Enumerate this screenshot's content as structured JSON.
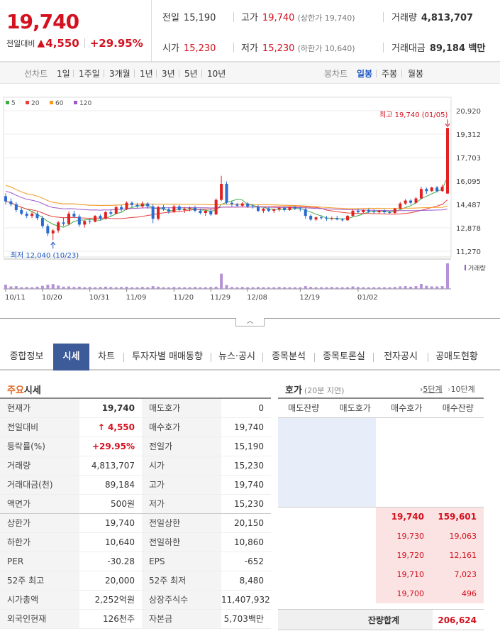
{
  "header": {
    "current_price": "19,740",
    "change_label": "전일대비",
    "change_amount": "4,550",
    "change_rate": "+29.95%",
    "prev_close_label": "전일",
    "prev_close": "15,190",
    "high_label": "고가",
    "high": "19,740",
    "upper_limit": "(상한가 19,740)",
    "volume_label": "거래량",
    "volume": "4,813,707",
    "open_label": "시가",
    "open": "15,230",
    "low_label": "저가",
    "low": "15,230",
    "lower_limit": "(하한가 10,640)",
    "amount_label": "거래대금",
    "amount": "89,184 백만"
  },
  "period_bar": {
    "line_label": "선차트",
    "line_periods": [
      "1일",
      "1주일",
      "3개월",
      "1년",
      "3년",
      "5년",
      "10년"
    ],
    "candle_label": "봉차트",
    "candle_periods": [
      "일봉",
      "주봉",
      "월봉"
    ],
    "active_candle": "일봉"
  },
  "chart_data": {
    "type": "candlestick",
    "ma_legend": [
      {
        "name": "5",
        "color": "#3fae49"
      },
      {
        "name": "20",
        "color": "#e8413b"
      },
      {
        "name": "60",
        "color": "#f39a1f"
      },
      {
        "name": "120",
        "color": "#9b59c9"
      }
    ],
    "y_ticks": [
      "20,920",
      "19,312",
      "17,703",
      "16,095",
      "14,487",
      "12,878",
      "11,270"
    ],
    "ylim": [
      11270,
      20920
    ],
    "x_ticks": [
      "10/11",
      "10/20",
      "10/31",
      "11/09",
      "11/20",
      "11/29",
      "12/08",
      "12/19",
      "01/02"
    ],
    "high_annotation": "최고 19,740 (01/05)",
    "low_annotation": "최저 12,040 (10/23)",
    "volume_label": "거래량",
    "candles": [
      [
        15050,
        15250,
        14500,
        14700
      ],
      [
        14700,
        14900,
        14350,
        14500
      ],
      [
        14500,
        14650,
        13950,
        14100
      ],
      [
        14100,
        14250,
        13750,
        13850
      ],
      [
        13850,
        14000,
        13550,
        13700
      ],
      [
        13700,
        14000,
        13550,
        13850
      ],
      [
        13850,
        14000,
        13400,
        13550
      ],
      [
        13550,
        13700,
        12850,
        13000
      ],
      [
        13000,
        13150,
        12300,
        12500
      ],
      [
        12500,
        12800,
        12040,
        12700
      ],
      [
        12700,
        13350,
        12550,
        13250
      ],
      [
        13250,
        13600,
        13000,
        13150
      ],
      [
        13150,
        14000,
        13050,
        13850
      ],
      [
        13850,
        14050,
        13550,
        13650
      ],
      [
        13650,
        13800,
        12950,
        13100
      ],
      [
        13100,
        13400,
        12900,
        13350
      ],
      [
        13350,
        13500,
        13150,
        13300
      ],
      [
        13300,
        13750,
        13250,
        13700
      ],
      [
        13700,
        13800,
        13400,
        13500
      ],
      [
        13500,
        14050,
        13450,
        13950
      ],
      [
        13950,
        14150,
        13700,
        13850
      ],
      [
        13850,
        14400,
        13800,
        14300
      ],
      [
        14300,
        14450,
        14000,
        14150
      ],
      [
        14150,
        14700,
        14100,
        14600
      ],
      [
        14600,
        14700,
        14300,
        14450
      ],
      [
        14450,
        14600,
        14250,
        14350
      ],
      [
        14350,
        14700,
        14250,
        14550
      ],
      [
        14550,
        14650,
        14200,
        14350
      ],
      [
        14350,
        14500,
        13200,
        13500
      ],
      [
        13500,
        14400,
        13400,
        14300
      ],
      [
        14300,
        14450,
        14050,
        14150
      ],
      [
        14150,
        14300,
        13850,
        14000
      ],
      [
        14000,
        14450,
        13900,
        14350
      ],
      [
        14350,
        14450,
        14000,
        14100
      ],
      [
        14100,
        14300,
        13900,
        14200
      ],
      [
        14200,
        14350,
        14000,
        14250
      ],
      [
        14250,
        14400,
        13950,
        14050
      ],
      [
        14050,
        14200,
        13800,
        13900
      ],
      [
        13900,
        14100,
        13700,
        14050
      ],
      [
        14050,
        14200,
        13700,
        13800
      ],
      [
        13800,
        14900,
        13750,
        14800
      ],
      [
        14800,
        16450,
        14700,
        15900
      ],
      [
        15900,
        16050,
        14500,
        14600
      ],
      [
        14600,
        14750,
        14350,
        14500
      ],
      [
        14500,
        14600,
        14300,
        14400
      ],
      [
        14400,
        14650,
        14300,
        14550
      ],
      [
        14550,
        14650,
        14250,
        14350
      ],
      [
        14350,
        14500,
        14200,
        14300
      ],
      [
        14300,
        14450,
        13950,
        14050
      ],
      [
        14050,
        14250,
        13900,
        14200
      ],
      [
        14200,
        14300,
        13950,
        14050
      ],
      [
        14050,
        14200,
        13900,
        14150
      ],
      [
        14150,
        14300,
        14000,
        14250
      ],
      [
        14250,
        14350,
        14000,
        14100
      ],
      [
        14100,
        14350,
        14050,
        14300
      ],
      [
        14300,
        14400,
        14100,
        14200
      ],
      [
        14200,
        14300,
        14000,
        14150
      ],
      [
        14150,
        14300,
        13500,
        13700
      ],
      [
        13700,
        13800,
        13350,
        13450
      ],
      [
        13450,
        13650,
        13350,
        13600
      ],
      [
        13600,
        13750,
        13450,
        13550
      ],
      [
        13550,
        13700,
        13350,
        13500
      ],
      [
        13500,
        13650,
        13400,
        13550
      ],
      [
        13550,
        13700,
        13400,
        13450
      ],
      [
        13450,
        13550,
        13300,
        13400
      ],
      [
        13400,
        13750,
        13350,
        13700
      ],
      [
        13700,
        14150,
        13650,
        14050
      ],
      [
        14050,
        14200,
        13850,
        13950
      ],
      [
        13950,
        14150,
        13900,
        14100
      ],
      [
        14100,
        14200,
        13900,
        14000
      ],
      [
        14000,
        14150,
        13850,
        13950
      ],
      [
        13950,
        14100,
        13850,
        14050
      ],
      [
        14050,
        14150,
        13850,
        13950
      ],
      [
        13950,
        14050,
        13850,
        13900
      ],
      [
        13900,
        14250,
        13850,
        14200
      ],
      [
        14200,
        14650,
        14150,
        14550
      ],
      [
        14550,
        14850,
        14450,
        14750
      ],
      [
        14750,
        14850,
        14500,
        14600
      ],
      [
        14600,
        15000,
        14550,
        14900
      ],
      [
        14900,
        15700,
        14850,
        15550
      ],
      [
        15550,
        15650,
        15200,
        15400
      ],
      [
        15400,
        15700,
        15350,
        15650
      ],
      [
        15650,
        15750,
        15300,
        15400
      ],
      [
        15400,
        15850,
        15350,
        15700
      ],
      [
        15230,
        19740,
        15230,
        19740
      ]
    ],
    "volumes": [
      30,
      18,
      20,
      12,
      14,
      12,
      16,
      22,
      30,
      35,
      24,
      16,
      18,
      14,
      16,
      12,
      14,
      12,
      14,
      16,
      14,
      12,
      14,
      16,
      12,
      12,
      14,
      12,
      20,
      16,
      12,
      12,
      14,
      12,
      12,
      12,
      14,
      12,
      12,
      14,
      16,
      110,
      28,
      14,
      12,
      14,
      12,
      12,
      14,
      12,
      12,
      12,
      14,
      12,
      12,
      12,
      12,
      20,
      14,
      12,
      12,
      12,
      14,
      12,
      12,
      12,
      18,
      14,
      12,
      12,
      12,
      12,
      12,
      12,
      14,
      18,
      20,
      16,
      20,
      36,
      22,
      18,
      18,
      20,
      185
    ]
  },
  "tabs": [
    "종합정보",
    "시세",
    "차트",
    "투자자별 매매동향",
    "뉴스·공시",
    "종목분석",
    "종목토론실",
    "전자공시",
    "공매도현황"
  ],
  "active_tab": "시세",
  "main_quotes": {
    "title_accent": "주요",
    "title_rest": "시세",
    "rows": [
      {
        "k1": "현재가",
        "v1": "19,740",
        "k2": "매도호가",
        "v2": "0"
      },
      {
        "k1": "전일대비",
        "v1": "4,550",
        "k2": "매수호가",
        "v2": "19,740"
      },
      {
        "k1": "등락률(%)",
        "v1": "+29.95%",
        "k2": "전일가",
        "v2": "15,190"
      },
      {
        "k1": "거래량",
        "v1": "4,813,707",
        "k2": "시가",
        "v2": "15,230"
      },
      {
        "k1": "거래대금(천)",
        "v1": "89,184",
        "k2": "고가",
        "v2": "19,740"
      },
      {
        "k1": "액면가",
        "v1": "500원",
        "k2": "저가",
        "v2": "15,230"
      },
      {
        "k1": "상한가",
        "v1": "19,740",
        "k2": "전일상한",
        "v2": "20,150"
      },
      {
        "k1": "하한가",
        "v1": "10,640",
        "k2": "전일하한",
        "v2": "10,860"
      },
      {
        "k1": "PER",
        "v1": "-30.28",
        "k2": "EPS",
        "v2": "-652"
      },
      {
        "k1": "52주 최고",
        "v1": "20,000",
        "k2": "52주 최저",
        "v2": "8,480"
      },
      {
        "k1": "시가총액",
        "v1": "2,252억원",
        "k2": "상장주식수",
        "v2": "11,407,932"
      },
      {
        "k1": "외국인현재",
        "v1": "126천주",
        "k2": "자본금",
        "v2": "5,703백만"
      }
    ]
  },
  "order_book": {
    "title": "호가",
    "delay": "(20분 지연)",
    "step5": "5단계",
    "step10": "10단계",
    "headers": [
      "매도잔량",
      "매도호가",
      "매수호가",
      "매수잔량"
    ],
    "bids": [
      {
        "price": "19,740",
        "qty": "159,601"
      },
      {
        "price": "19,730",
        "qty": "19,063"
      },
      {
        "price": "19,720",
        "qty": "12,161"
      },
      {
        "price": "19,710",
        "qty": "7,023"
      },
      {
        "price": "19,700",
        "qty": "496"
      }
    ],
    "total_label": "잔량합계",
    "total_value": "206,624"
  }
}
